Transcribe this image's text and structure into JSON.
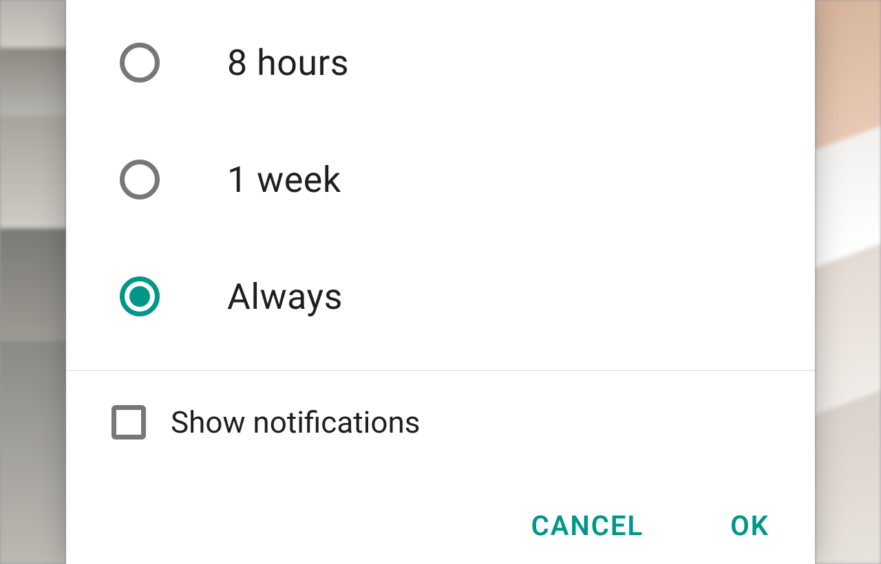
{
  "accent_color": "#009788",
  "options": [
    {
      "label": "8 hours",
      "selected": false
    },
    {
      "label": "1 week",
      "selected": false
    },
    {
      "label": "Always",
      "selected": true
    }
  ],
  "checkbox": {
    "label": "Show notifications",
    "checked": false
  },
  "buttons": {
    "cancel": "CANCEL",
    "ok": "OK"
  }
}
